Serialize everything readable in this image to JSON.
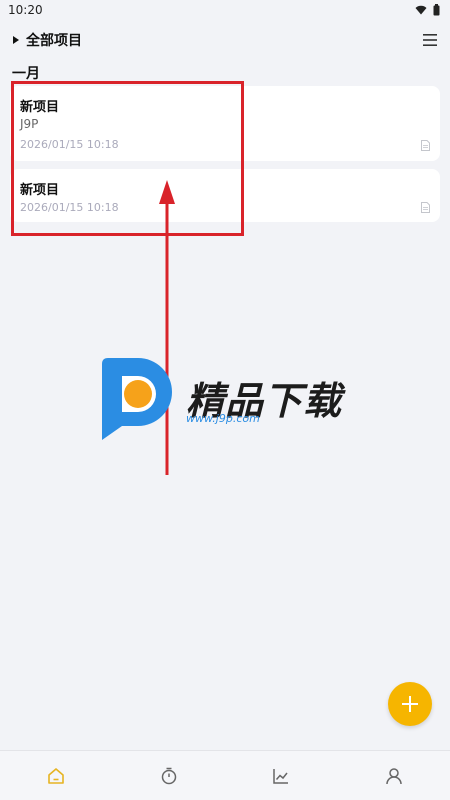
{
  "status_bar": {
    "time": "10:20",
    "icons": [
      "wifi-icon",
      "battery-icon"
    ]
  },
  "header": {
    "title": "全部项目",
    "expand_icon": "triangle-right-icon",
    "menu_icon": "menu-icon"
  },
  "month": "一月",
  "projects": [
    {
      "title": "新项目",
      "subtitle": "J9P",
      "datetime": "2026/01/15  10:18",
      "icon": "document-icon"
    },
    {
      "title": "新项目",
      "datetime": "2026/01/15  10:18",
      "icon": "document-icon"
    }
  ],
  "watermark": {
    "name": "精品下载",
    "url": "www.j9p.com"
  },
  "fab": {
    "icon": "plus-icon"
  },
  "bottom_nav": [
    {
      "icon": "home-icon",
      "active": true
    },
    {
      "icon": "timer-icon",
      "active": false
    },
    {
      "icon": "chart-icon",
      "active": false
    },
    {
      "icon": "user-icon",
      "active": false
    }
  ],
  "colors": {
    "accent": "#f6b500",
    "background": "#f2f3f7",
    "annotation": "#d9232a",
    "nav_active": "#e6b422",
    "nav_inactive": "#666666"
  }
}
